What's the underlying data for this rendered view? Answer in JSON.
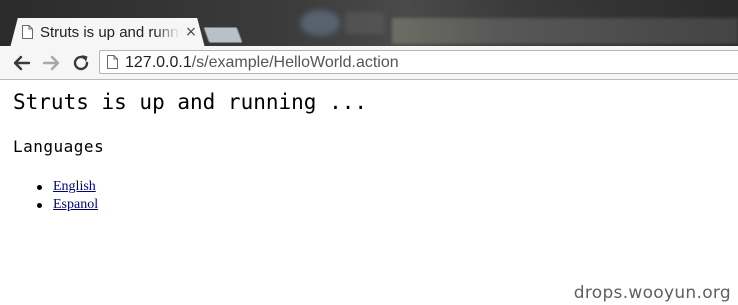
{
  "tab": {
    "title": "Struts is up and running ...",
    "close_glyph": "×"
  },
  "toolbar": {
    "url_host": "127.0.0.1",
    "url_path": "/s/example/HelloWorld.action"
  },
  "page": {
    "heading": "Struts is up and running ...",
    "subheading": "Languages",
    "languages": [
      {
        "label": "English"
      },
      {
        "label": "Espanol"
      }
    ]
  },
  "watermark": "drops.wooyun.org",
  "colors": {
    "link": "#00007a",
    "tab_bg": "#f6f6f6"
  },
  "icons": [
    "page-icon",
    "back-arrow-icon",
    "forward-arrow-icon",
    "reload-icon",
    "close-icon"
  ]
}
